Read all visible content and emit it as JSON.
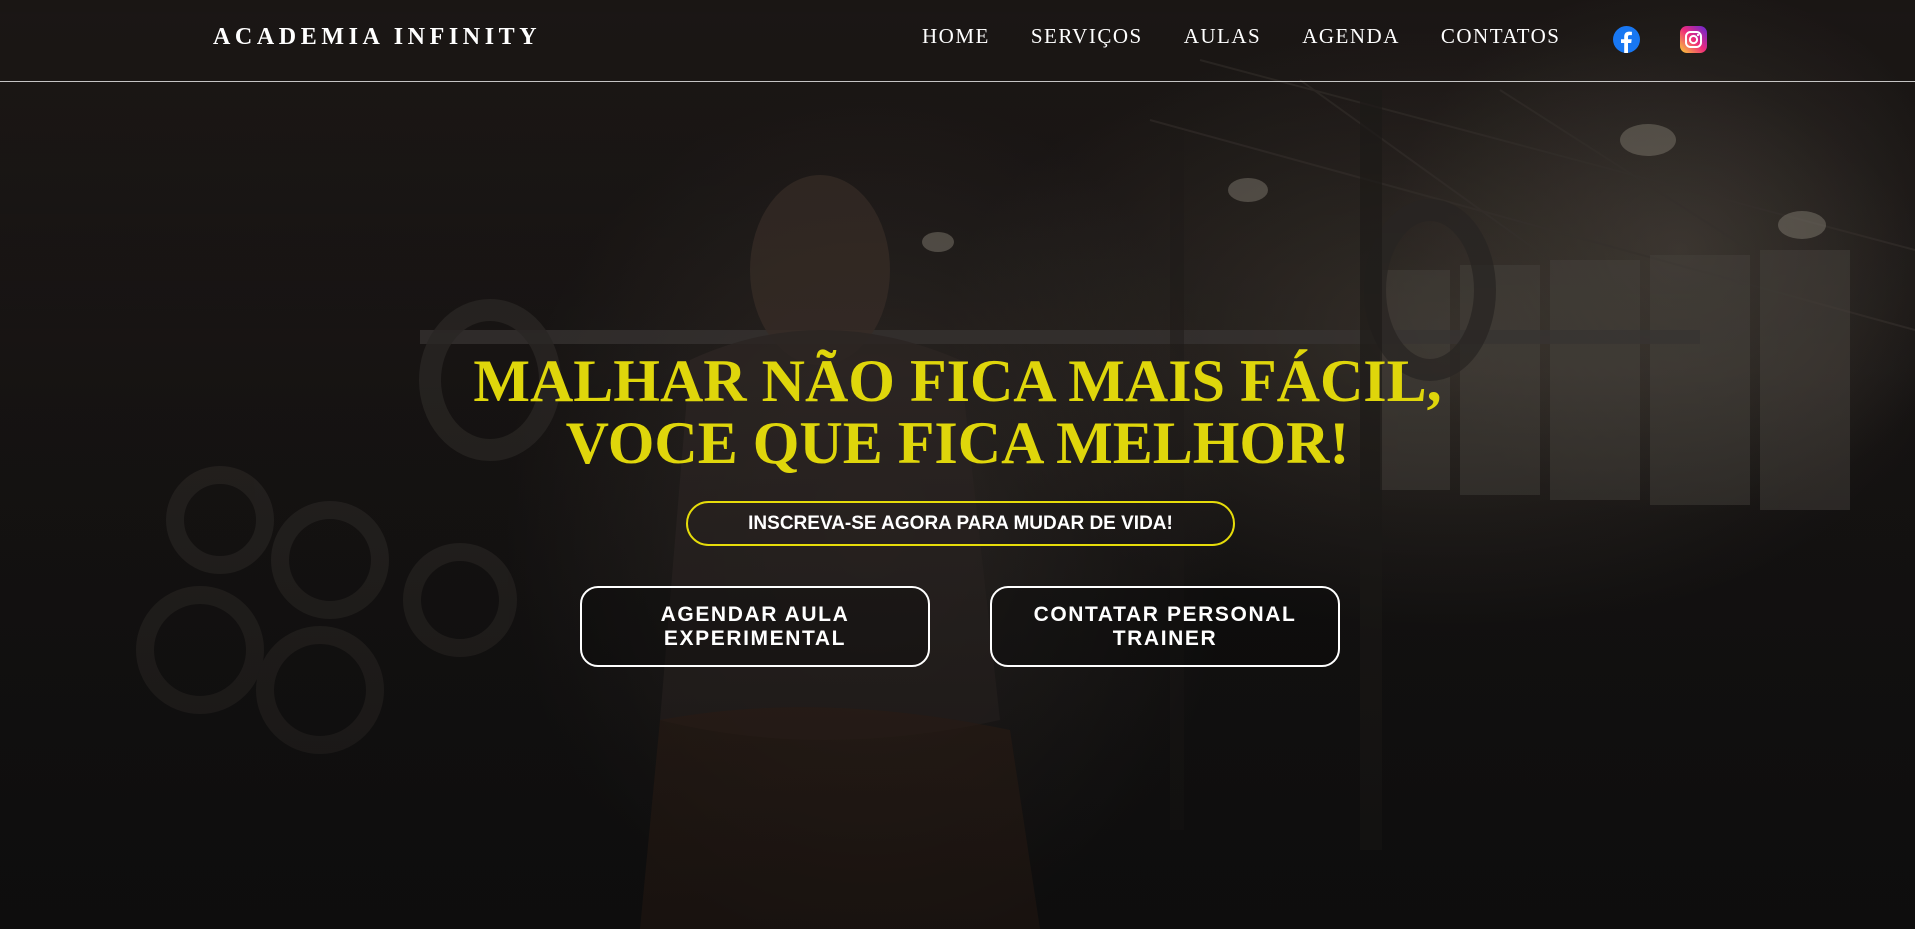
{
  "brand": {
    "name": "ACADEMIA INFINITY"
  },
  "nav": {
    "items": [
      {
        "label": "HOME"
      },
      {
        "label": "SERVIÇOS"
      },
      {
        "label": "AULAS"
      },
      {
        "label": "AGENDA"
      },
      {
        "label": "CONTATOS"
      }
    ],
    "social": [
      {
        "icon": "facebook-icon",
        "color": "#1877f2"
      },
      {
        "icon": "instagram-icon",
        "color": "#ee2a7b"
      }
    ]
  },
  "hero": {
    "headline_line1": "MALHAR NÃO FICA MAIS FÁCIL,",
    "headline_line2": "VOCE QUE FICA MELHOR!",
    "headline_color": "#dfd60b",
    "subscribe_label": "INSCREVA-SE AGORA PARA MUDAR DE VIDA!",
    "cta_trial": "AGENDAR AULA EXPERIMENTAL",
    "cta_personal": "CONTATAR PERSONAL TRAINER"
  }
}
